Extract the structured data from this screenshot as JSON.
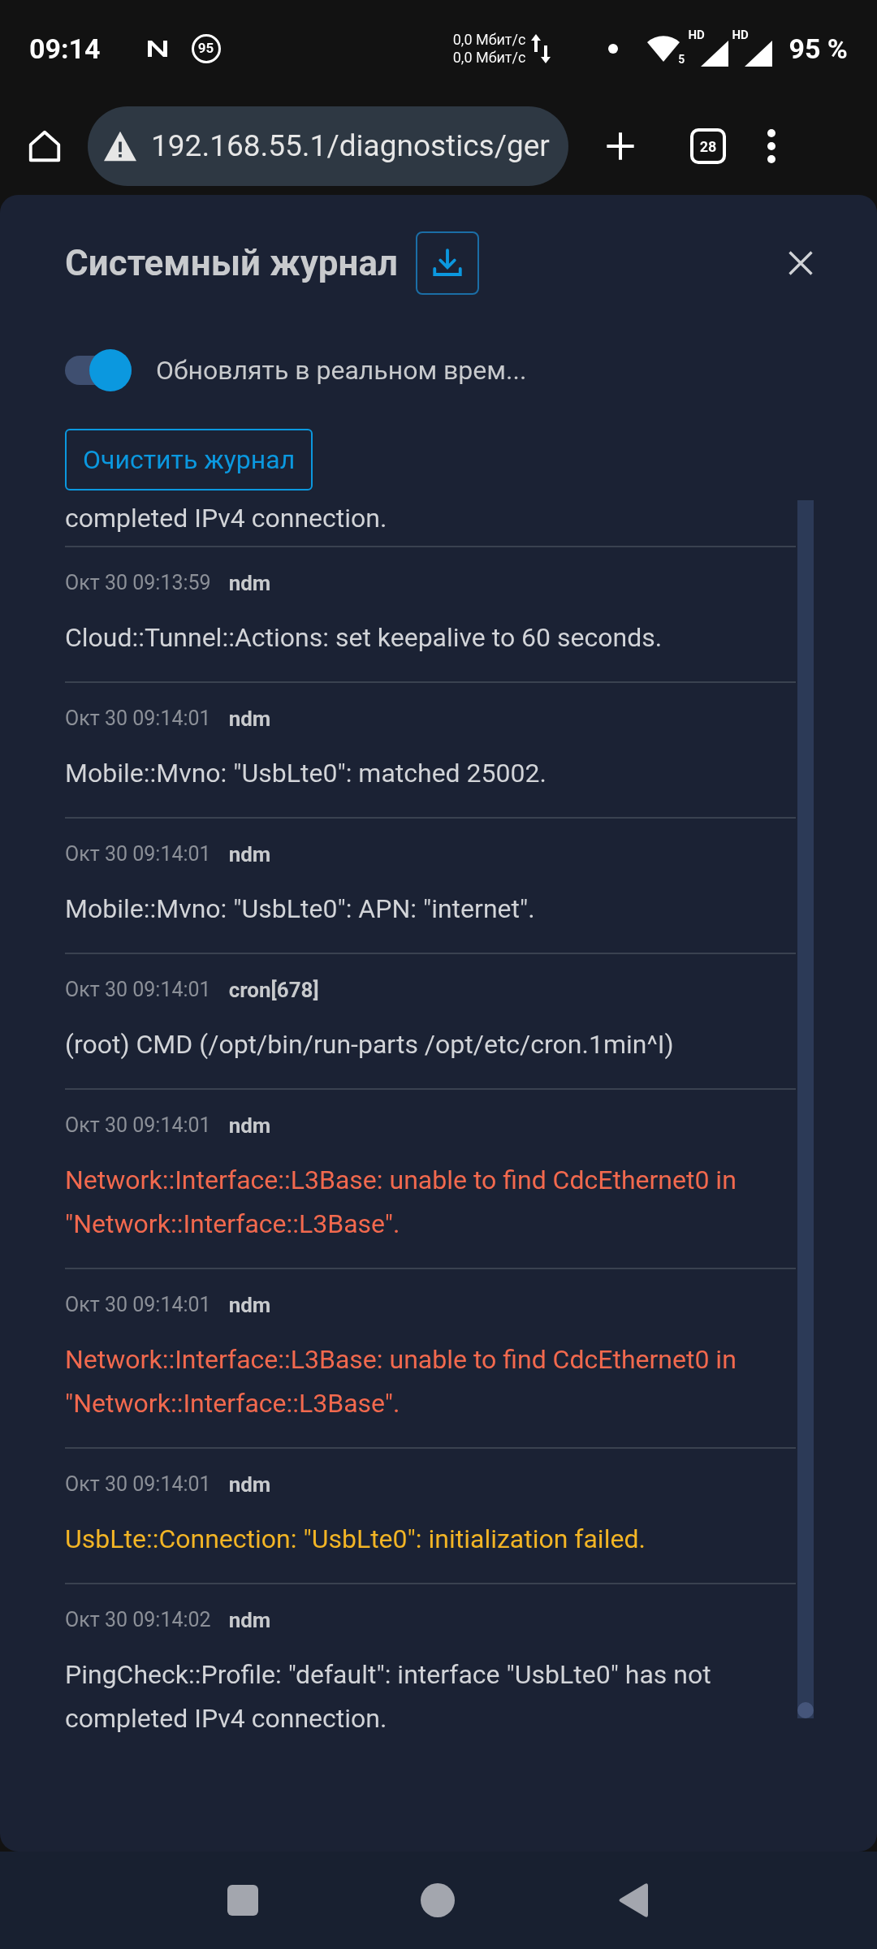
{
  "status_bar": {
    "time": "09:14",
    "notification_badge": "95",
    "net_speed_up": "0,0 Мбит/с",
    "net_speed_down": "0,0 Мбит/с",
    "wifi_label": "5",
    "sim_labels": [
      "HD",
      "HD"
    ],
    "battery": "95 %"
  },
  "browser": {
    "url": "192.168.55.1/diagnostics/ger",
    "tab_count": "28"
  },
  "dialog": {
    "title": "Системный журнал",
    "live_update": {
      "label": "Обновлять в реальном врем...",
      "on": true
    },
    "clear_button": "Очистить журнал"
  },
  "log": {
    "cut_top": "completed IPv4 connection.",
    "entries": [
      {
        "time": "Окт 30 09:13:59",
        "source": "ndm",
        "message": "Cloud::Tunnel::Actions: set keepalive to 60 seconds.",
        "kind": "info"
      },
      {
        "time": "Окт 30 09:14:01",
        "source": "ndm",
        "message": "Mobile::Mvno: \"UsbLte0\": matched 25002.",
        "kind": "info"
      },
      {
        "time": "Окт 30 09:14:01",
        "source": "ndm",
        "message": "Mobile::Mvno: \"UsbLte0\": APN: \"internet\".",
        "kind": "info"
      },
      {
        "time": "Окт 30 09:14:01",
        "source": "cron[678]",
        "message": "(root) CMD (/opt/bin/run-parts /opt/etc/cron.1min^I)",
        "kind": "info"
      },
      {
        "time": "Окт 30 09:14:01",
        "source": "ndm",
        "message": "Network::Interface::L3Base: unable to find CdcEthernet0 in \"Network::Interface::L3Base\".",
        "kind": "error"
      },
      {
        "time": "Окт 30 09:14:01",
        "source": "ndm",
        "message": "Network::Interface::L3Base: unable to find CdcEthernet0 in \"Network::Interface::L3Base\".",
        "kind": "error"
      },
      {
        "time": "Окт 30 09:14:01",
        "source": "ndm",
        "message": "UsbLte::Connection: \"UsbLte0\": initialization failed.",
        "kind": "warning"
      },
      {
        "time": "Окт 30 09:14:02",
        "source": "ndm",
        "message": "PingCheck::Profile: \"default\": interface \"UsbLte0\" has not completed IPv4 connection.",
        "kind": "info"
      }
    ]
  }
}
